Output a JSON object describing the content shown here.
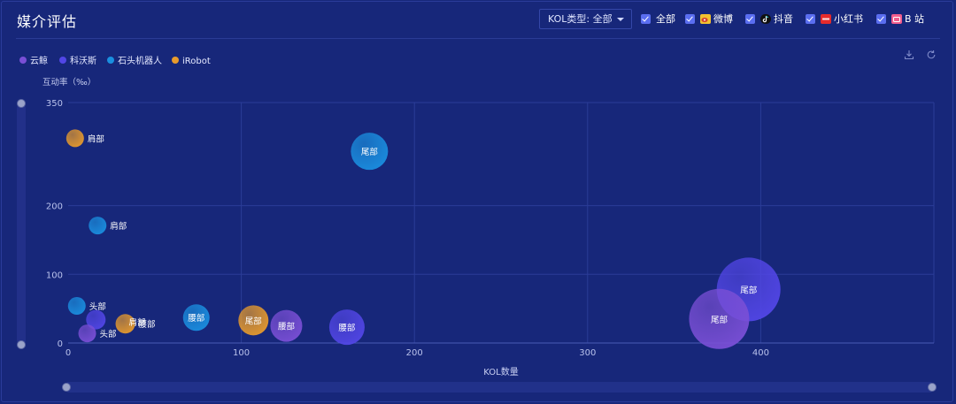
{
  "header": {
    "title": "媒介评估",
    "kol_select": {
      "label": "KOL类型:",
      "value": "全部"
    },
    "platforms": [
      {
        "label": "全部",
        "checked": true,
        "icon": ""
      },
      {
        "label": "微博",
        "checked": true,
        "icon": "weibo-icon"
      },
      {
        "label": "抖音",
        "checked": true,
        "icon": "douyin-icon"
      },
      {
        "label": "小红书",
        "checked": true,
        "icon": "xiaohongshu-icon"
      },
      {
        "label": "B 站",
        "checked": true,
        "icon": "bilibili-icon"
      }
    ]
  },
  "colors": {
    "云鲸": "#7a4fd6",
    "科沃斯": "#5246e6",
    "石头机器人": "#1a8fe0",
    "iRobot": "#e89b2c"
  },
  "chart_data": {
    "type": "scatter",
    "title": "",
    "xlabel": "KOL数量",
    "ylabel": "互动率（‰）",
    "xlim": [
      0,
      400
    ],
    "ylim": [
      0,
      350
    ],
    "xticks": [
      0,
      100,
      200,
      300,
      400
    ],
    "yticks": [
      0,
      100,
      200,
      350
    ],
    "grid": true,
    "legend_position": "top-left",
    "series": [
      {
        "name": "云鲸",
        "points": [
          {
            "x": 11,
            "y": 14,
            "size": 10,
            "label": "头部"
          },
          {
            "x": 126,
            "y": 25,
            "size": 18,
            "label": "腰部"
          },
          {
            "x": 376,
            "y": 35,
            "size": 34,
            "label": "尾部"
          }
        ]
      },
      {
        "name": "科沃斯",
        "points": [
          {
            "x": 16,
            "y": 34,
            "size": 11,
            "label": ""
          },
          {
            "x": 161,
            "y": 23,
            "size": 20,
            "label": "腰部"
          },
          {
            "x": 393,
            "y": 78,
            "size": 36,
            "label": "尾部"
          }
        ]
      },
      {
        "name": "石头机器人",
        "points": [
          {
            "x": 5,
            "y": 54,
            "size": 10,
            "label": "头部"
          },
          {
            "x": 17,
            "y": 171,
            "size": 10,
            "label": "肩部"
          },
          {
            "x": 74,
            "y": 37,
            "size": 15,
            "label": "腰部"
          },
          {
            "x": 174,
            "y": 279,
            "size": 21,
            "label": "尾部"
          }
        ]
      },
      {
        "name": "iRobot",
        "points": [
          {
            "x": 4,
            "y": 298,
            "size": 10,
            "label": "肩部"
          },
          {
            "x": 33,
            "y": 28,
            "size": 11,
            "label": "腰部"
          },
          {
            "x": 107,
            "y": 33,
            "size": 17,
            "label": "尾部"
          }
        ]
      }
    ],
    "extra_labels": [
      {
        "text": "肩部",
        "x": 34,
        "y": 31
      }
    ]
  }
}
